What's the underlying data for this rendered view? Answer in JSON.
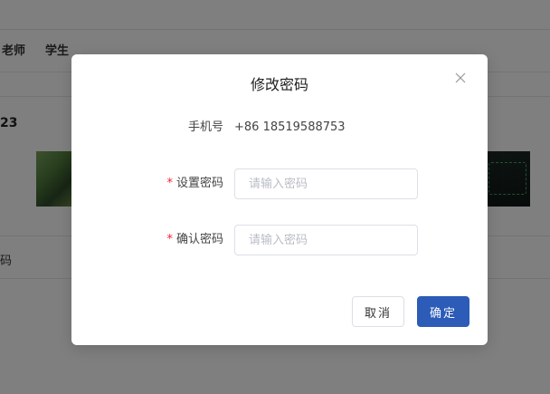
{
  "background": {
    "tabs": [
      "老师",
      "学生"
    ],
    "partial_number": "23",
    "partial_text": "码"
  },
  "modal": {
    "title": "修改密码",
    "phone_label": "手机号",
    "phone_value": "+86 18519588753",
    "required_mark": "*",
    "set_password_label": "设置密码",
    "set_password_placeholder": "请输入密码",
    "confirm_password_label": "确认密码",
    "confirm_password_placeholder": "请输入密码",
    "cancel_label": "取消",
    "ok_label": "确定"
  },
  "colors": {
    "primary": "#2c5bb8",
    "required": "#f5222d",
    "overlay": "rgba(0,0,0,0.5)"
  }
}
